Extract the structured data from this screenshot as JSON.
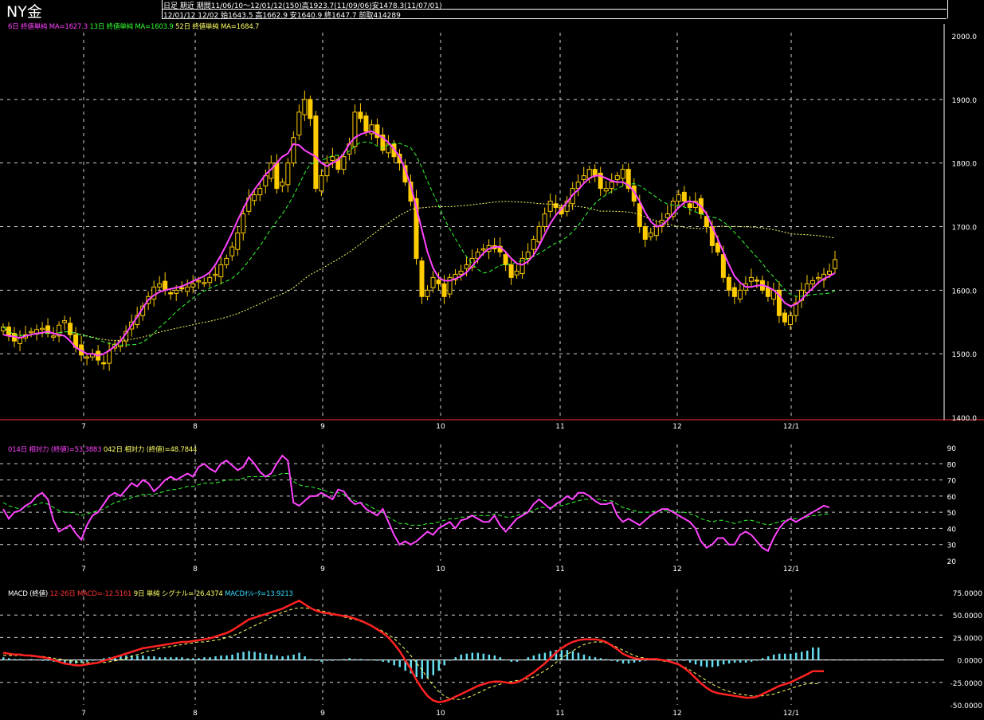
{
  "title": "NY金",
  "header": {
    "line1": "日足  期近  期間11/06/10～12/01/12(150)高1923.7(11/09/06)安1478.3(11/07/01)",
    "line2": "12/01/12 12/02 始1643.5 高1662.9 安1640.9 終1647.7 前取414289"
  },
  "legends": {
    "price": [
      {
        "text": "6日 終値単純 MA=1627.3",
        "color": "#ff44ff"
      },
      {
        "text": "13日 終値単純 MA=1603.9",
        "color": "#33ff33"
      },
      {
        "text": "52日 終値単純 MA=1684.7",
        "color": "#ffff66"
      }
    ],
    "rsi": [
      {
        "text": "014日 相対力 (終値)=53.3883",
        "color": "#ff44ff"
      },
      {
        "text": "042日 相対力 (終値)=48.7844",
        "color": "#ffff66"
      }
    ],
    "macd": [
      {
        "text": "MACD (終値)",
        "color": "#ffffff"
      },
      {
        "text": "12-26日 MACD=-12.5161",
        "color": "#ff3333"
      },
      {
        "text": "9日 単純 シグナル=-26.4374",
        "color": "#ffff66"
      },
      {
        "text": "MACDｵｼﾚｰﾀ=13.9213",
        "color": "#33ddff"
      }
    ]
  },
  "chart_data": [
    {
      "type": "candlestick",
      "ylim": [
        1400,
        2000
      ],
      "y_ticks": [
        "2000.0",
        "1900.0",
        "1800.0",
        "1700.0",
        "1600.0",
        "1500.0",
        "1400.0"
      ],
      "x_ticks": [
        "7",
        "8",
        "9",
        "10",
        "11",
        "12",
        "12/1"
      ],
      "colors": {
        "candle": "#ffcc00",
        "ma6": "#ff44ff",
        "ma13": "#33ff33",
        "ma52": "#ffff66"
      },
      "ohlc_approx": {
        "note_free": true,
        "close": [
          1542,
          1528,
          1520,
          1525,
          1530,
          1535,
          1538,
          1540,
          1532,
          1528,
          1545,
          1552,
          1530,
          1510,
          1498,
          1495,
          1500,
          1490,
          1485,
          1505,
          1515,
          1520,
          1535,
          1550,
          1560,
          1575,
          1590,
          1605,
          1610,
          1600,
          1595,
          1600,
          1602,
          1605,
          1610,
          1615,
          1612,
          1620,
          1625,
          1640,
          1650,
          1668,
          1690,
          1720,
          1745,
          1750,
          1760,
          1780,
          1800,
          1760,
          1770,
          1800,
          1840,
          1880,
          1900,
          1870,
          1760,
          1780,
          1800,
          1810,
          1790,
          1810,
          1830,
          1880,
          1870,
          1850,
          1860,
          1840,
          1820,
          1830,
          1810,
          1800,
          1770,
          1740,
          1650,
          1590,
          1600,
          1620,
          1610,
          1590,
          1620,
          1625,
          1630,
          1640,
          1650,
          1660,
          1665,
          1670,
          1665,
          1660,
          1640,
          1620,
          1630,
          1650,
          1660,
          1680,
          1700,
          1720,
          1740,
          1730,
          1720,
          1740,
          1760,
          1770,
          1780,
          1790,
          1780,
          1760,
          1760,
          1770,
          1780,
          1790,
          1760,
          1740,
          1700,
          1680,
          1690,
          1700,
          1710,
          1720,
          1740,
          1750,
          1740,
          1730,
          1740,
          1720,
          1700,
          1670,
          1660,
          1620,
          1600,
          1590,
          1600,
          1610,
          1620,
          1615,
          1600,
          1590,
          1600,
          1560,
          1550,
          1560,
          1580,
          1600,
          1610,
          1615,
          1620,
          1625,
          1630,
          1648
        ],
        "ma6": [
          1530,
          1528,
          1527,
          1525,
          1528,
          1530,
          1532,
          1533,
          1535,
          1532,
          1530,
          1528,
          1520,
          1510,
          1505,
          1500,
          1500,
          1497,
          1500,
          1505,
          1512,
          1520,
          1532,
          1545,
          1558,
          1572,
          1585,
          1592,
          1597,
          1600,
          1602,
          1604,
          1606,
          1610,
          1614,
          1618,
          1622,
          1628,
          1640,
          1655,
          1672,
          1690,
          1710,
          1728,
          1745,
          1758,
          1770,
          1782,
          1790,
          1800,
          1810,
          1815,
          1830,
          1828,
          1820,
          1815,
          1810,
          1800,
          1795,
          1800,
          1805,
          1815,
          1830,
          1840,
          1845,
          1848,
          1850,
          1845,
          1840,
          1832,
          1822,
          1810,
          1790,
          1765,
          1730,
          1695,
          1660,
          1635,
          1620,
          1615,
          1615,
          1618,
          1622,
          1628,
          1638,
          1648,
          1658,
          1665,
          1668,
          1668,
          1660,
          1650,
          1642,
          1640,
          1645,
          1655,
          1670,
          1688,
          1705,
          1718,
          1728,
          1738,
          1750,
          1758,
          1768,
          1776,
          1780,
          1780,
          1776,
          1772,
          1770,
          1770,
          1765,
          1755,
          1740,
          1722,
          1708,
          1700,
          1702,
          1710,
          1720,
          1730,
          1738,
          1740,
          1738,
          1732,
          1720,
          1700,
          1680,
          1660,
          1640,
          1622,
          1612,
          1605,
          1605,
          1607,
          1608,
          1605,
          1600,
          1592,
          1580,
          1575,
          1578,
          1585,
          1595,
          1603,
          1612,
          1618,
          1622,
          1627
        ]
      }
    },
    {
      "type": "line",
      "name_series": [
        "014日 相対力",
        "042日 相対力"
      ],
      "ylim": [
        20,
        90
      ],
      "y_ticks": [
        "90",
        "80",
        "70",
        "60",
        "50",
        "40",
        "30",
        "20"
      ],
      "x_ticks": [
        "7",
        "8",
        "9",
        "10",
        "11",
        "12",
        "12/1"
      ],
      "rsi14": [
        52,
        46,
        50,
        51,
        54,
        56,
        60,
        62,
        58,
        45,
        38,
        40,
        42,
        37,
        33,
        42,
        48,
        50,
        55,
        60,
        62,
        60,
        64,
        68,
        66,
        70,
        68,
        63,
        66,
        70,
        72,
        70,
        72,
        74,
        72,
        78,
        80,
        77,
        75,
        80,
        82,
        79,
        76,
        78,
        84,
        80,
        75,
        72,
        74,
        80,
        85,
        82,
        56,
        54,
        57,
        60,
        60,
        62,
        60,
        58,
        64,
        63,
        58,
        55,
        56,
        52,
        50,
        48,
        52,
        44,
        36,
        30,
        32,
        30,
        32,
        35,
        38,
        36,
        40,
        42,
        44,
        40,
        45,
        46,
        48,
        46,
        44,
        44,
        48,
        42,
        38,
        42,
        46,
        48,
        50,
        55,
        58,
        55,
        52,
        55,
        57,
        60,
        58,
        62,
        62,
        60,
        57,
        55,
        55,
        56,
        48,
        44,
        46,
        44,
        42,
        45,
        48,
        50,
        52,
        52,
        50,
        48,
        46,
        44,
        40,
        32,
        28,
        30,
        34,
        34,
        30,
        30,
        36,
        38,
        36,
        32,
        28,
        26,
        34,
        40,
        44,
        46,
        44,
        46,
        48,
        50,
        52,
        54,
        53
      ],
      "rsi42": [
        56,
        54,
        53,
        52,
        53,
        54,
        55,
        56,
        55,
        53,
        51,
        50,
        50,
        49,
        48,
        49,
        50,
        51,
        52,
        54,
        56,
        57,
        58,
        59,
        60,
        61,
        61,
        61,
        62,
        63,
        64,
        64,
        65,
        66,
        66,
        67,
        68,
        68,
        68,
        69,
        70,
        70,
        70,
        71,
        72,
        72,
        72,
        72,
        72,
        73,
        74,
        74,
        69,
        67,
        66,
        66,
        65,
        64,
        63,
        62,
        62,
        61,
        59,
        57,
        56,
        55,
        53,
        51,
        50,
        47,
        45,
        43,
        43,
        42,
        42,
        42,
        43,
        43,
        44,
        45,
        46,
        46,
        47,
        47,
        48,
        48,
        48,
        48,
        49,
        48,
        47,
        47,
        48,
        49,
        50,
        51,
        53,
        53,
        53,
        54,
        54,
        55,
        56,
        57,
        58,
        58,
        58,
        58,
        57,
        57,
        55,
        53,
        52,
        51,
        50,
        50,
        50,
        51,
        51,
        51,
        51,
        50,
        50,
        49,
        48,
        46,
        45,
        44,
        45,
        45,
        44,
        43,
        44,
        45,
        45,
        44,
        43,
        42,
        43,
        44,
        45,
        46,
        46,
        46,
        47,
        48,
        48,
        49,
        48.8
      ]
    },
    {
      "type": "line+bar",
      "ylim": [
        -50,
        75
      ],
      "y_ticks": [
        "75.0000",
        "50.0000",
        "25.0000",
        "0.0000",
        "-25.0000",
        "-50.0000"
      ],
      "x_ticks": [
        "7",
        "8",
        "9",
        "10",
        "11",
        "12",
        "12/1"
      ],
      "macd": [
        8,
        7,
        6,
        6,
        5,
        5,
        4,
        3,
        2,
        0,
        -2,
        -4,
        -5,
        -6,
        -6,
        -5,
        -4,
        -3,
        -1,
        1,
        3,
        5,
        7,
        9,
        11,
        13,
        14,
        15,
        16,
        17,
        18,
        19,
        20,
        20,
        21,
        22,
        23,
        24,
        26,
        28,
        30,
        33,
        37,
        41,
        45,
        47,
        49,
        51,
        53,
        55,
        57,
        60,
        63,
        66,
        62,
        58,
        55,
        53,
        52,
        51,
        50,
        49,
        48,
        46,
        44,
        41,
        38,
        34,
        30,
        25,
        18,
        10,
        0,
        -10,
        -22,
        -32,
        -40,
        -45,
        -47,
        -46,
        -44,
        -41,
        -38,
        -35,
        -32,
        -29,
        -27,
        -25,
        -24,
        -24,
        -25,
        -26,
        -25,
        -22,
        -18,
        -14,
        -9,
        -4,
        2,
        8,
        13,
        17,
        20,
        22,
        23,
        23,
        23,
        22,
        20,
        16,
        12,
        7,
        4,
        2,
        1,
        1,
        1,
        1,
        0,
        -1,
        -3,
        -5,
        -9,
        -14,
        -20,
        -26,
        -31,
        -35,
        -37,
        -38,
        -39,
        -40,
        -41,
        -42,
        -42,
        -41,
        -38,
        -35,
        -32,
        -29,
        -27,
        -25,
        -22,
        -19,
        -16,
        -12.5,
        -12.5,
        -12.5
      ],
      "signal": [
        5,
        5,
        5,
        5,
        5,
        4,
        4,
        4,
        3,
        2,
        1,
        0,
        -1,
        -2,
        -3,
        -3,
        -3,
        -3,
        -3,
        -2,
        -1,
        0,
        2,
        4,
        6,
        8,
        10,
        11,
        13,
        14,
        15,
        16,
        17,
        18,
        19,
        20,
        20,
        21,
        22,
        23,
        25,
        27,
        29,
        32,
        35,
        38,
        41,
        44,
        47,
        50,
        53,
        55,
        57,
        58,
        58,
        57,
        56,
        55,
        53,
        52,
        50,
        48,
        46,
        45,
        43,
        41,
        38,
        35,
        32,
        28,
        24,
        18,
        12,
        5,
        -3,
        -11,
        -20,
        -28,
        -35,
        -40,
        -43,
        -44,
        -44,
        -42,
        -40,
        -37,
        -34,
        -31,
        -29,
        -27,
        -25,
        -24,
        -23,
        -22,
        -21,
        -19,
        -16,
        -12,
        -8,
        -3,
        2,
        6,
        10,
        14,
        17,
        19,
        20,
        20,
        19,
        17,
        14,
        11,
        8,
        5,
        3,
        2,
        1,
        0,
        -1,
        -2,
        -3,
        -5,
        -8,
        -11,
        -15,
        -19,
        -23,
        -27,
        -30,
        -33,
        -35,
        -37,
        -38,
        -39,
        -40,
        -40,
        -40,
        -39,
        -38,
        -36,
        -34,
        -32,
        -30,
        -28,
        -26.4,
        -26.4,
        -26.4
      ]
    }
  ]
}
